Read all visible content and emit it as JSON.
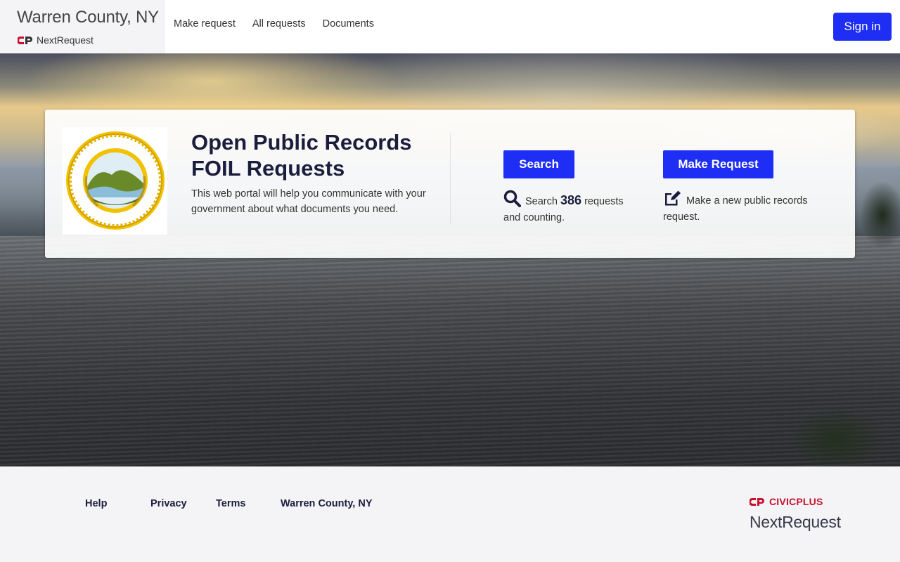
{
  "header": {
    "brand_title": "Warren County, NY",
    "brand_sub": "NextRequest",
    "nav": [
      "Make request",
      "All requests",
      "Documents"
    ],
    "signin_label": "Sign in"
  },
  "card": {
    "title_line1": "Open Public Records",
    "title_line2": "FOIL Requests",
    "description": "This web portal will help you communicate with your government about what documents you need.",
    "search_button": "Search",
    "search_prefix": "Search",
    "search_count": "386",
    "search_suffix": "requests and counting.",
    "make_button": "Make Request",
    "make_text": "Make a new public records request."
  },
  "footer": {
    "links": [
      "Help",
      "Privacy",
      "Terms",
      "Warren County, NY"
    ],
    "civic_label": "CIVICPLUS",
    "next_label": "NextRequest"
  },
  "colors": {
    "accent": "#1e2ef5",
    "brand_red": "#c8102e",
    "title_navy": "#1b1d3d"
  },
  "icons": {
    "search": "search-icon",
    "edit": "edit-icon",
    "seal": "county-seal"
  }
}
